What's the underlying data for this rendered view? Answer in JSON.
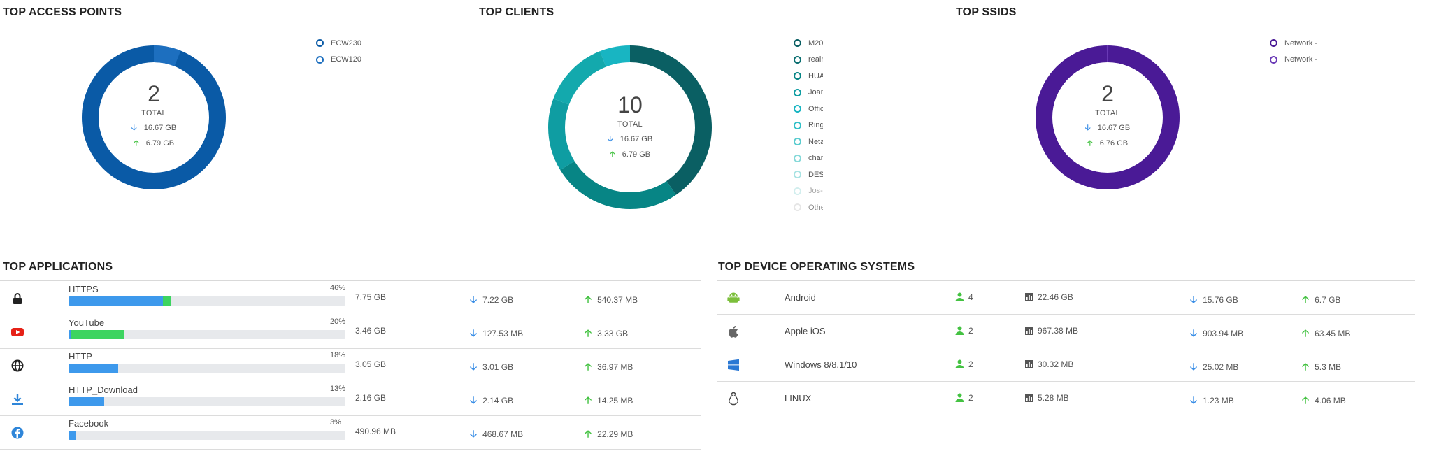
{
  "sections": {
    "access_points": {
      "title": "TOP ACCESS POINTS",
      "total": "2",
      "total_label": "TOTAL",
      "down": "16.67 GB",
      "up": "6.79 GB",
      "legend": [
        "ECW230",
        "ECW120"
      ],
      "color": "#0a5aa6"
    },
    "clients": {
      "title": "TOP CLIENTS",
      "total": "10",
      "total_label": "TOTAL",
      "down": "16.67 GB",
      "up": "6.79 GB",
      "legend": [
        "M20",
        "realn",
        "HUAV",
        "Joan",
        "Offic",
        "Ring-",
        "Neta",
        "chan",
        "DESI",
        "Jos-i",
        "Othe"
      ],
      "color": "#0e8a8a"
    },
    "ssids": {
      "title": "TOP SSIDS",
      "total": "2",
      "total_label": "TOTAL",
      "down": "16.67 GB",
      "up": "6.76 GB",
      "legend": [
        "Network -",
        "Network -"
      ],
      "color": "#4a1a96"
    },
    "applications": {
      "title": "TOP APPLICATIONS",
      "rows": [
        {
          "icon": "lock-icon",
          "name": "HTTPS",
          "pct": "46%",
          "blue": 0.34,
          "green": 0.03,
          "total": "7.75 GB",
          "down": "7.22 GB",
          "up": "540.37 MB"
        },
        {
          "icon": "youtube-icon",
          "name": "YouTube",
          "pct": "20%",
          "blue": 0.01,
          "green": 0.19,
          "total": "3.46 GB",
          "down": "127.53 MB",
          "up": "3.33 GB"
        },
        {
          "icon": "globe-icon",
          "name": "HTTP",
          "pct": "18%",
          "blue": 0.18,
          "green": 0,
          "total": "3.05 GB",
          "down": "3.01 GB",
          "up": "36.97 MB"
        },
        {
          "icon": "download-icon",
          "name": "HTTP_Download",
          "pct": "13%",
          "blue": 0.13,
          "green": 0,
          "total": "2.16 GB",
          "down": "2.14 GB",
          "up": "14.25 MB"
        },
        {
          "icon": "facebook-icon",
          "name": "Facebook",
          "pct": "3%",
          "blue": 0.025,
          "green": 0,
          "total": "490.96 MB",
          "down": "468.67 MB",
          "up": "22.29 MB"
        }
      ]
    },
    "os": {
      "title": "TOP DEVICE OPERATING SYSTEMS",
      "rows": [
        {
          "icon": "android-icon",
          "name": "Android",
          "users": "4",
          "usage": "22.46 GB",
          "down": "15.76 GB",
          "up": "6.7 GB"
        },
        {
          "icon": "apple-icon",
          "name": "Apple iOS",
          "users": "2",
          "usage": "967.38 MB",
          "down": "903.94 MB",
          "up": "63.45 MB"
        },
        {
          "icon": "windows-icon",
          "name": "Windows 8/8.1/10",
          "users": "2",
          "usage": "30.32 MB",
          "down": "25.02 MB",
          "up": "5.3 MB"
        },
        {
          "icon": "linux-icon",
          "name": "LINUX",
          "users": "2",
          "usage": "5.28 MB",
          "down": "1.23 MB",
          "up": "4.06 MB"
        }
      ]
    }
  },
  "arrows": {
    "down": "🡣",
    "up": "🡡"
  },
  "colors": {
    "blue": "#3d99ec",
    "green": "#3dd460",
    "down_arrow": "#3a8ee6",
    "up_arrow": "#44c242"
  }
}
